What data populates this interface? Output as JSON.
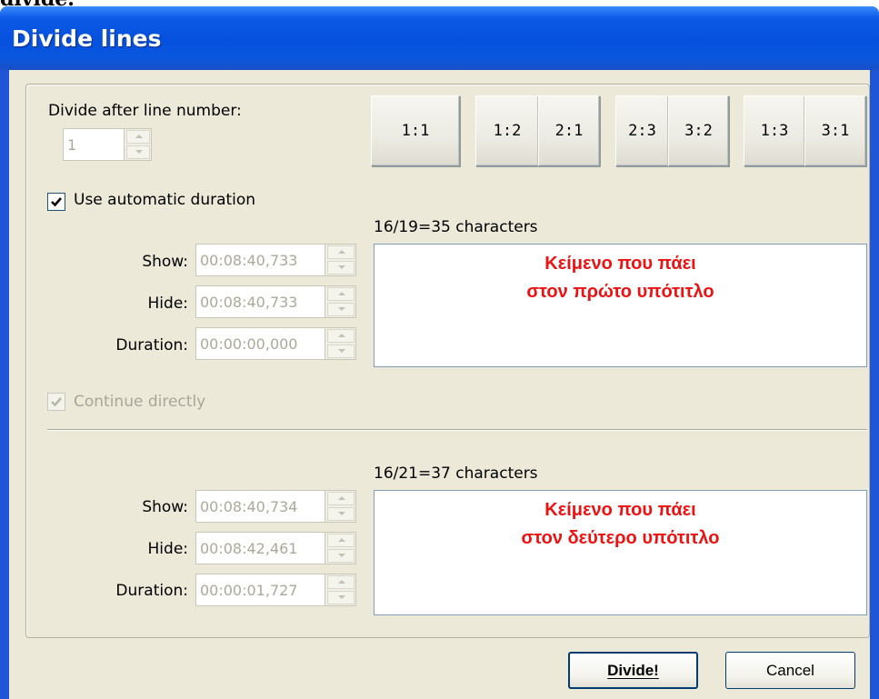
{
  "crop_text": "divide.",
  "window": {
    "title": "Divide lines"
  },
  "divide_after": {
    "label": "Divide after line number:",
    "value": "1"
  },
  "ratio_buttons": [
    "1:1",
    "1:2",
    "2:1",
    "2:3",
    "3:2",
    "1:3",
    "3:1"
  ],
  "auto_duration": {
    "label": "Use automatic duration",
    "checked": true
  },
  "first": {
    "char_info": "16/19=35 characters",
    "show_label": "Show:",
    "show_value": "00:08:40,733",
    "hide_label": "Hide:",
    "hide_value": "00:08:40,733",
    "duration_label": "Duration:",
    "duration_value": "00:00:00,000",
    "text_line1": "Κείμενο που πάει",
    "text_line2": "στον πρώτο υπότιτλο"
  },
  "continue_directly": {
    "label": "Continue directly",
    "checked": true
  },
  "second": {
    "char_info": "16/21=37 characters",
    "show_label": "Show:",
    "show_value": "00:08:40,734",
    "hide_label": "Hide:",
    "hide_value": "00:08:42,461",
    "duration_label": "Duration:",
    "duration_value": "00:00:01,727",
    "text_line1": "Κείμενο που πάει",
    "text_line2": "στον δεύτερο υπότιτλο"
  },
  "buttons": {
    "divide": "Divide!",
    "cancel": "Cancel"
  },
  "colors": {
    "titlebar": "#0551dd",
    "dialog_bg": "#ece9d8",
    "subtitle_text": "#ee1111"
  }
}
